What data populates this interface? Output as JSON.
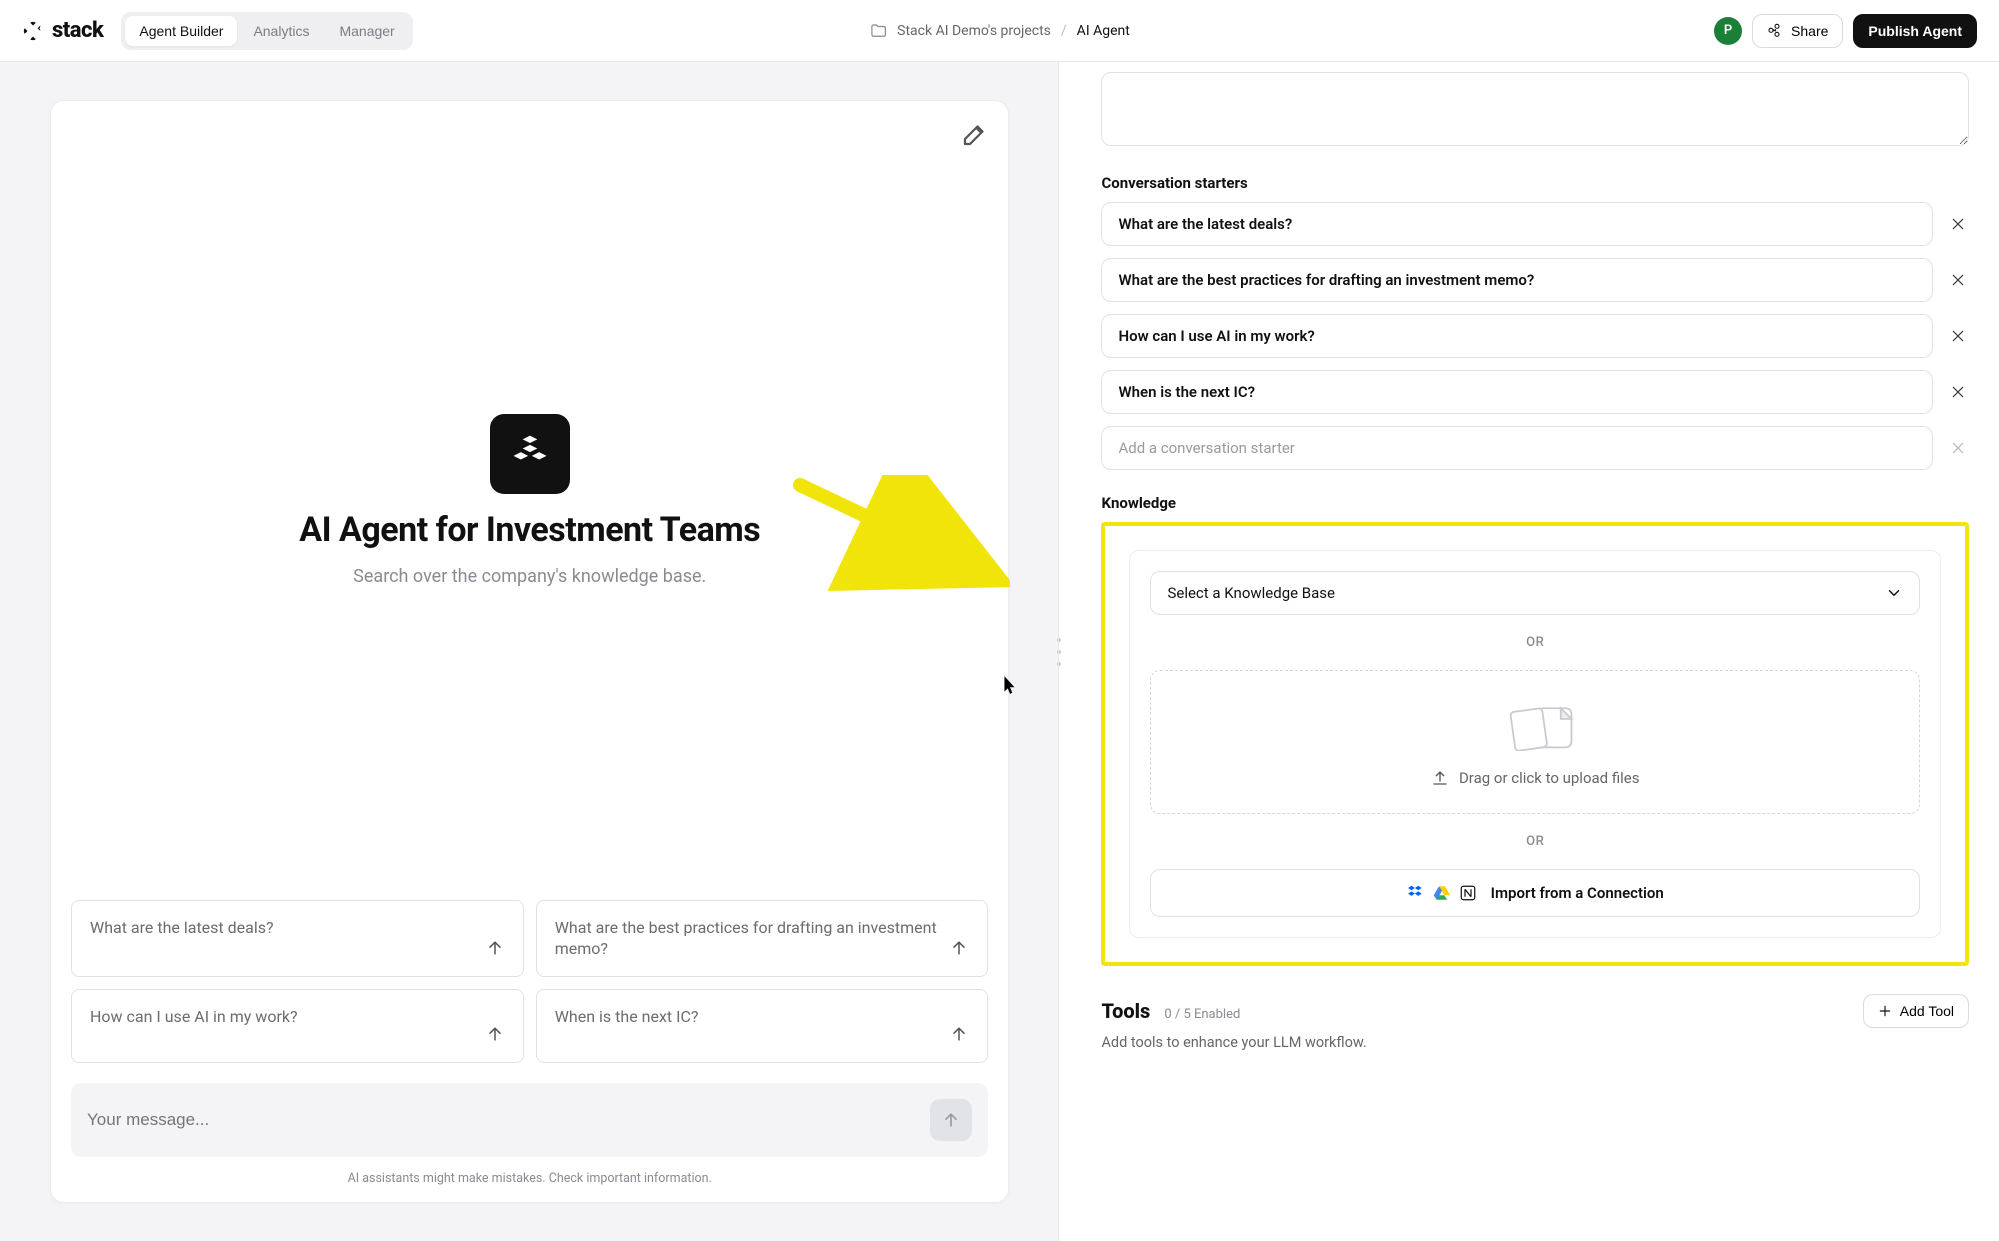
{
  "brand": "stack",
  "tabs": [
    "Agent Builder",
    "Analytics",
    "Manager"
  ],
  "active_tab": 0,
  "breadcrumb": {
    "project": "Stack AI Demo's projects",
    "current": "AI Agent"
  },
  "avatar_initial": "P",
  "share_label": "Share",
  "publish_label": "Publish Agent",
  "preview": {
    "title": "AI Agent for Investment Teams",
    "subtitle": "Search over the company's knowledge base.",
    "starters": [
      "What are the latest deals?",
      "What are the best practices for drafting an investment memo?",
      "How can I use AI in my work?",
      "When is the next IC?"
    ],
    "input_placeholder": "Your message...",
    "disclaimer": "AI assistants might make mistakes. Check important information."
  },
  "config": {
    "starters_heading": "Conversation starters",
    "starters": [
      "What are the latest deals?",
      "What are the best practices for drafting an investment memo?",
      "How can I use AI in my work?",
      "When is the next IC?"
    ],
    "add_starter_placeholder": "Add a conversation starter",
    "knowledge_heading": "Knowledge",
    "kb_select_placeholder": "Select a Knowledge Base",
    "or_label": "OR",
    "upload_label": "Drag or click to upload files",
    "import_label": "Import from a Connection",
    "tools": {
      "title": "Tools",
      "count_label": "0 / 5 Enabled",
      "subtitle": "Add tools to enhance your LLM workflow.",
      "add_label": "Add Tool"
    }
  }
}
